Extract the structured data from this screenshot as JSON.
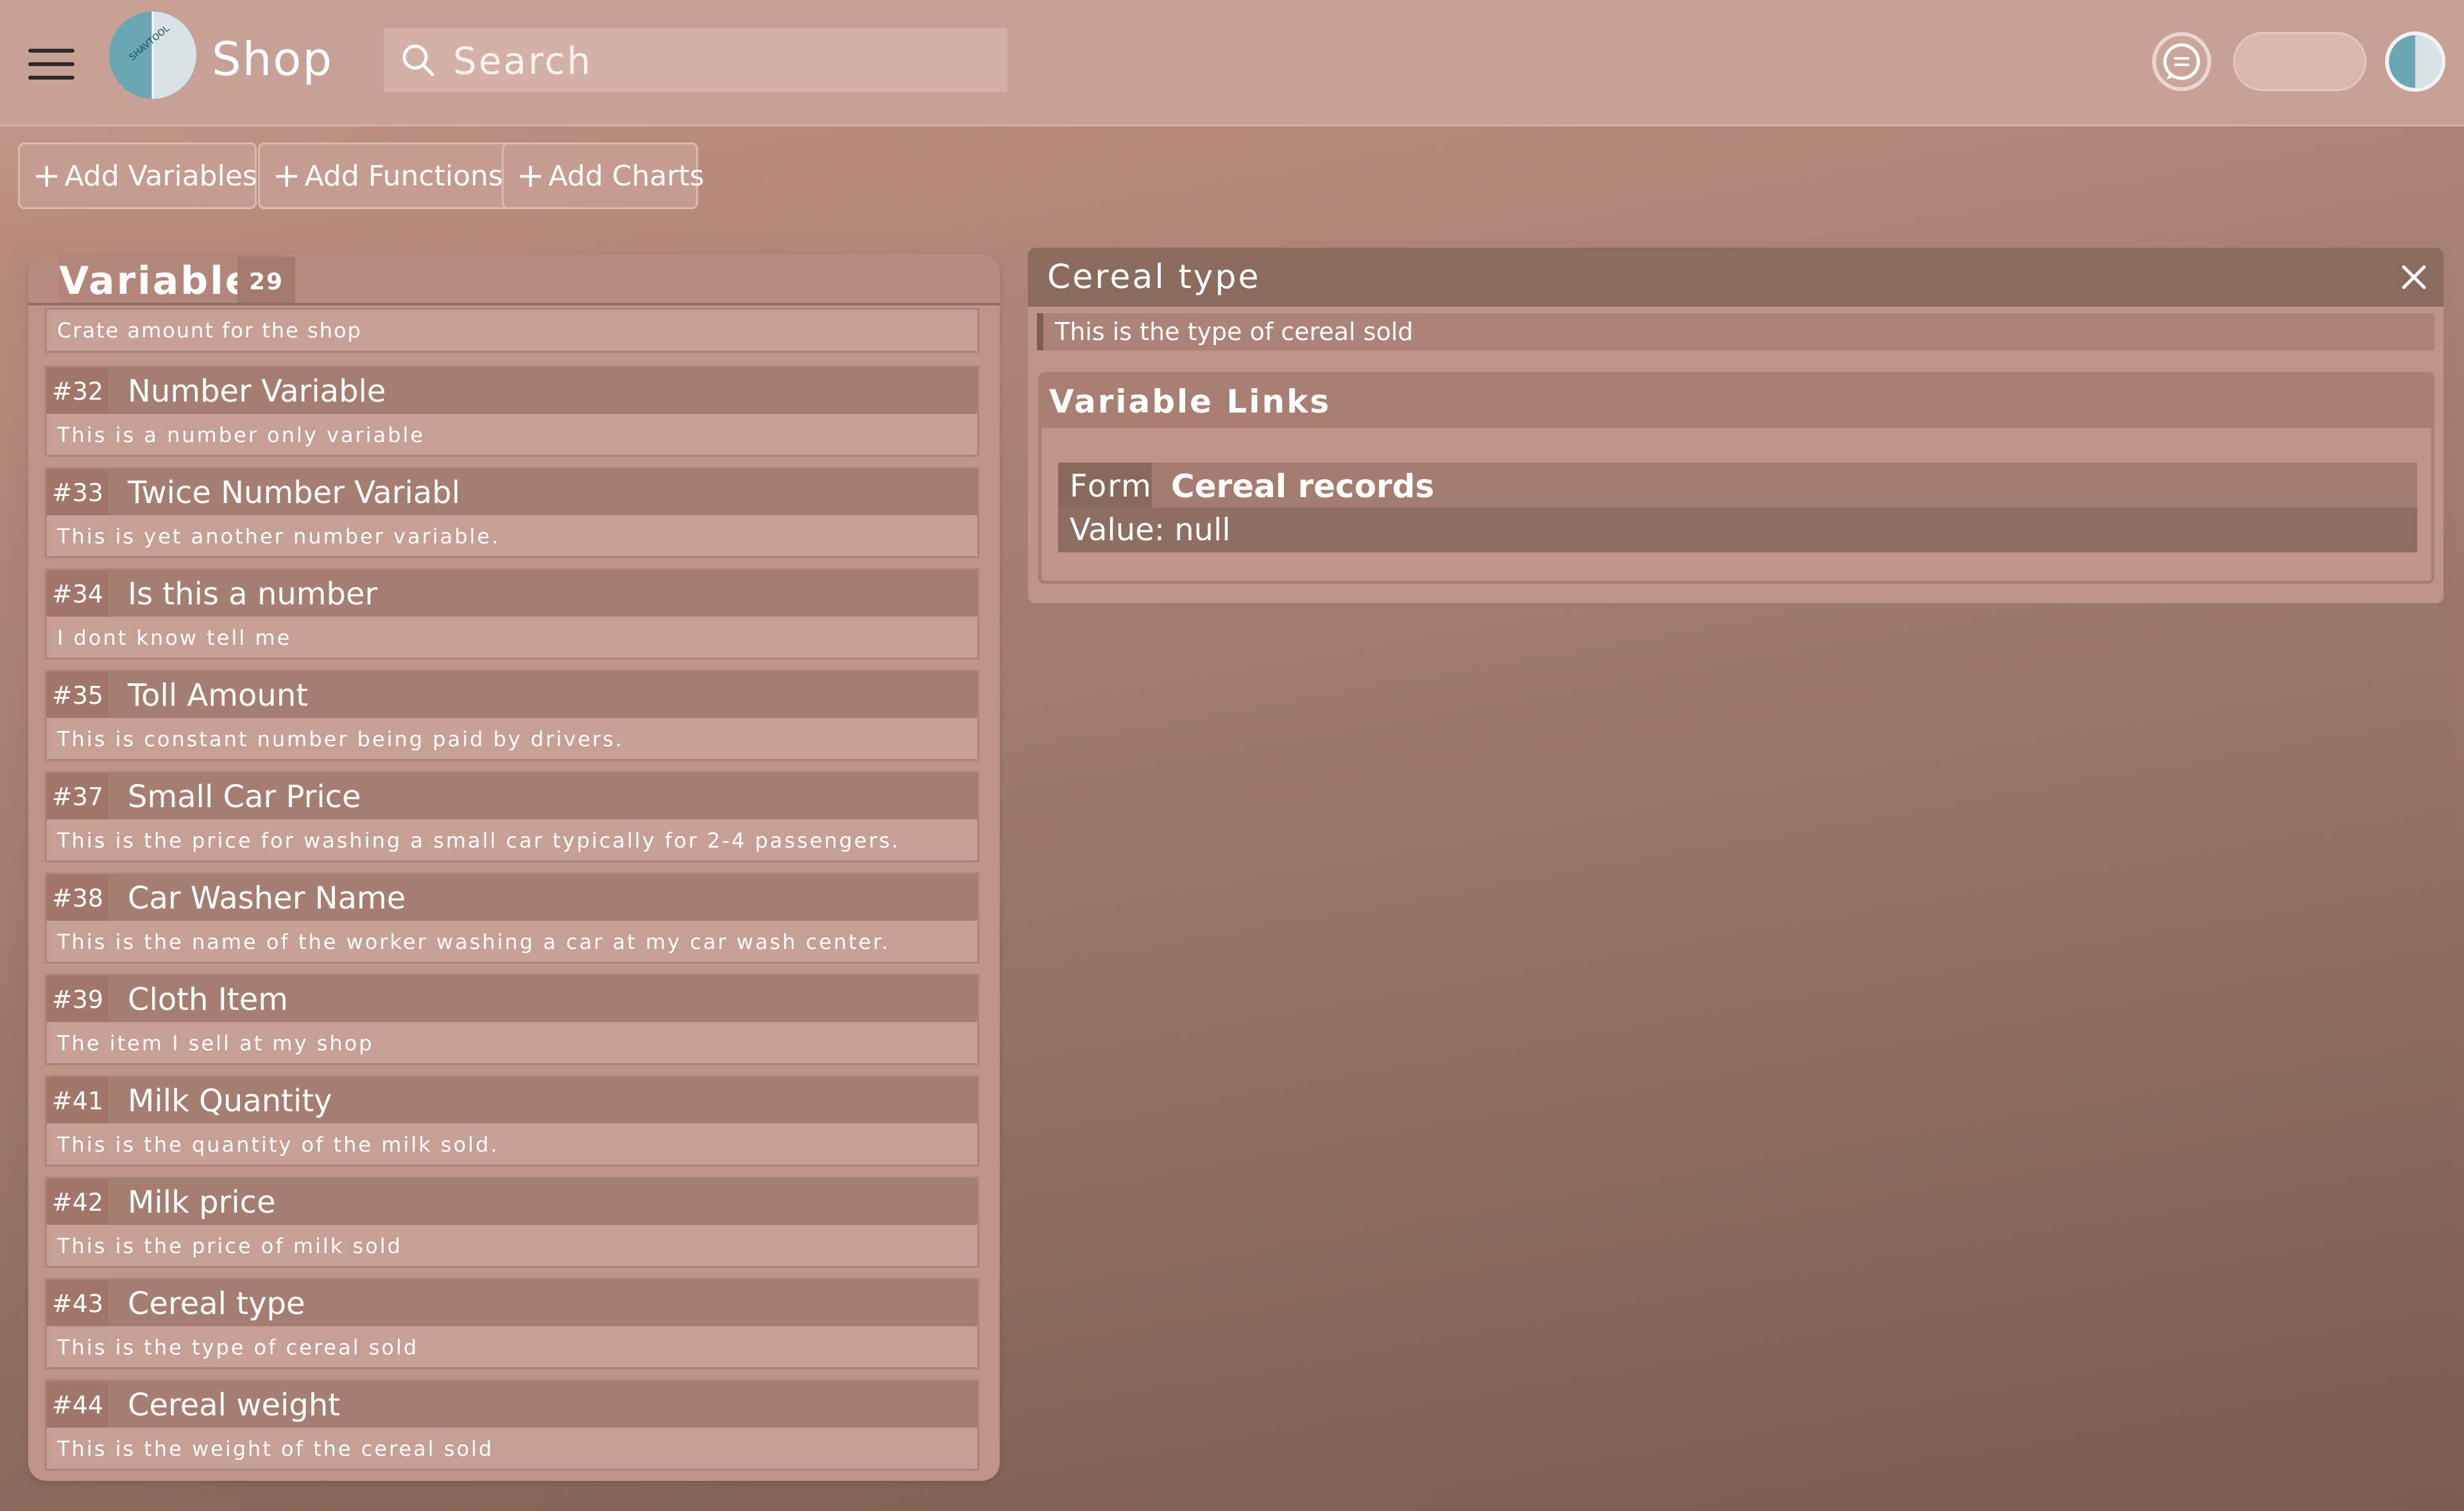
{
  "header": {
    "app_name": "Shop",
    "search_placeholder": "Search",
    "menu_icon": "hamburger-menu-icon",
    "logo_icon": "shop-logo-icon",
    "chat_icon": "chat-icon",
    "avatar_icon": "user-avatar-icon"
  },
  "toolbar": {
    "buttons": [
      {
        "label": "Add Variables",
        "icon": "+"
      },
      {
        "label": "Add Functions",
        "icon": "+"
      },
      {
        "label": "Add Charts",
        "icon": "+"
      }
    ]
  },
  "variables_panel": {
    "title": "Variables",
    "count": "29",
    "first_description": "Crate amount for the shop",
    "items": [
      {
        "id": "#32",
        "name": "Number Variable",
        "description": "This is a number only variable"
      },
      {
        "id": "#33",
        "name": "Twice Number Variabl",
        "description": "This is yet another number variable."
      },
      {
        "id": "#34",
        "name": "Is this a number",
        "description": "I dont know tell me"
      },
      {
        "id": "#35",
        "name": "Toll Amount",
        "description": "This is constant number being paid by drivers."
      },
      {
        "id": "#37",
        "name": "Small Car Price",
        "description": "This is the price for washing a small car typically for 2-4 passengers."
      },
      {
        "id": "#38",
        "name": "Car Washer Name",
        "description": "This is the name of the worker washing a car at my car wash center."
      },
      {
        "id": "#39",
        "name": "Cloth Item",
        "description": "The item I sell at my shop"
      },
      {
        "id": "#41",
        "name": "Milk Quantity",
        "description": "This is the quantity of the milk sold."
      },
      {
        "id": "#42",
        "name": "Milk price",
        "description": "This is the price of milk sold"
      },
      {
        "id": "#43",
        "name": "Cereal type",
        "description": "This is the type of cereal sold"
      },
      {
        "id": "#44",
        "name": "Cereal weight",
        "description": "This is the weight of the cereal sold"
      }
    ]
  },
  "detail_panel": {
    "title": "Cereal type",
    "description": "This is the type of cereal sold",
    "links_title": "Variable Links",
    "link": {
      "type": "Form",
      "name": "Cereal records",
      "value": "Value: null"
    }
  },
  "colors": {
    "topbar": "#c7a196",
    "panel": "#c19386",
    "card_header": "#a67d71",
    "detail_header": "#8c6b5f"
  }
}
